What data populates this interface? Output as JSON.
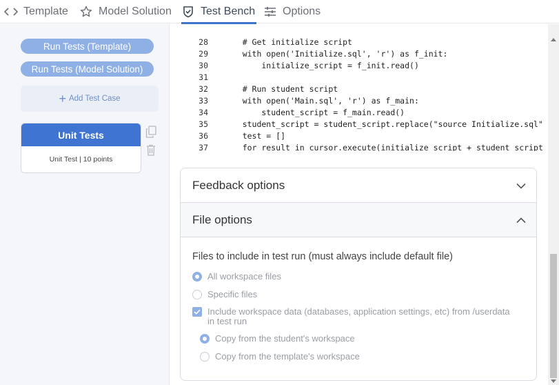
{
  "tabs": [
    {
      "label": "Template",
      "icon": "code-icon",
      "active": false
    },
    {
      "label": "Model Solution",
      "icon": "star-icon",
      "active": false
    },
    {
      "label": "Test Bench",
      "icon": "shield-check-icon",
      "active": true
    },
    {
      "label": "Options",
      "icon": "sliders-icon",
      "active": false
    }
  ],
  "left": {
    "run_template": "Run Tests (Template)",
    "run_model": "Run Tests (Model Solution)",
    "add_test_case": "Add Test Case",
    "unit_card": {
      "title": "Unit Tests",
      "subtitle": "Unit Test | 10 points"
    }
  },
  "code": {
    "lines": [
      {
        "n": "28",
        "text": "    # Get initialize script"
      },
      {
        "n": "29",
        "text": "    with open('Initialize.sql', 'r') as f_init:"
      },
      {
        "n": "30",
        "text": "        initialize_script = f_init.read()"
      },
      {
        "n": "31",
        "text": ""
      },
      {
        "n": "32",
        "text": "    # Run student script"
      },
      {
        "n": "33",
        "text": "    with open('Main.sql', 'r') as f_main:"
      },
      {
        "n": "34",
        "text": "        student_script = f_main.read()"
      },
      {
        "n": "35",
        "text": "    student_script = student_script.replace(\"source Initialize.sql\""
      },
      {
        "n": "36",
        "text": "    test = []"
      },
      {
        "n": "37",
        "text": "    for result in cursor.execute(initialize_script + student_script"
      }
    ]
  },
  "accordion": {
    "feedback_title": "Feedback options",
    "file_title": "File options",
    "files_heading": "Files to include in test run (must always include default file)",
    "opt_all": "All workspace files",
    "opt_specific": "Specific files",
    "include_data_line1": "Include workspace data (databases, application settings, etc) from /userdata",
    "include_data_line2": "in test run",
    "copy_student": "Copy from the student's workspace",
    "copy_template": "Copy from the template's workspace"
  },
  "colors": {
    "accent": "#3f74d2",
    "accent_light": "#8fb0e4",
    "active_tab_underline": "#3e73c9"
  }
}
